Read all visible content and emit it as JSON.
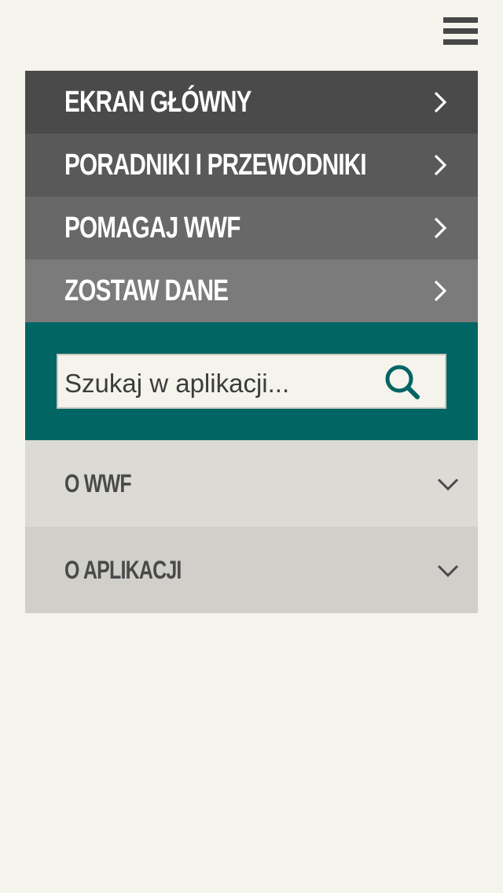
{
  "menu": {
    "hamburger_icon": "hamburger-menu-icon",
    "items": [
      {
        "label": "EKRAN GŁÓWNY",
        "bg": "#4a4a4a",
        "icon": "chevron-right-icon"
      },
      {
        "label": "PORADNIKI I PRZEWODNIKI",
        "bg": "#595959",
        "icon": "chevron-right-icon"
      },
      {
        "label": "POMAGAJ WWF",
        "bg": "#686868",
        "icon": "chevron-right-icon"
      },
      {
        "label": "ZOSTAW DANE",
        "bg": "#7b7b7b",
        "icon": "chevron-right-icon"
      }
    ]
  },
  "search": {
    "placeholder": "Szukaj w aplikacji...",
    "value": "",
    "icon": "search-icon",
    "panel_bg": "#006563",
    "icon_color": "#006563"
  },
  "accordion": {
    "items": [
      {
        "label": "O WWF",
        "bg": "#dcdad5",
        "icon": "chevron-down-icon"
      },
      {
        "label": "O APLIKACJI",
        "bg": "#d1cfca",
        "icon": "chevron-down-icon"
      }
    ]
  },
  "colors": {
    "page_bg": "#f4f3ec",
    "nav_text": "#ffffff",
    "accordion_text": "#4a4a4a"
  }
}
